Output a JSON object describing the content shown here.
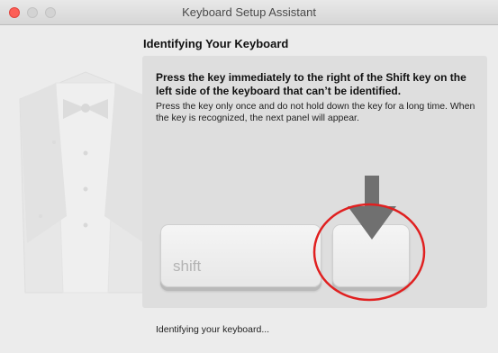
{
  "window": {
    "title": "Keyboard Setup Assistant",
    "controls": [
      "close-button",
      "minimize-button",
      "zoom-button"
    ]
  },
  "main": {
    "heading": "Identifying Your Keyboard",
    "instruction_bold": "Press the key immediately to the right of the Shift key on the left side of the keyboard that can’t be identified.",
    "instruction": "Press the key only once and do not hold down the key for a long time. When the key is recognized, the next panel will appear.",
    "keys": {
      "shift_label": "shift",
      "target_label": ""
    },
    "status": "Identifying your keyboard..."
  },
  "colors": {
    "close": "#fc5f57",
    "highlight_circle": "#e02020",
    "arrow": "#707070",
    "panel": "#dedede"
  },
  "icons": {
    "decoration": "tuxedo-icon",
    "pointer": "down-arrow-icon",
    "highlight": "red-circle-annotation"
  }
}
